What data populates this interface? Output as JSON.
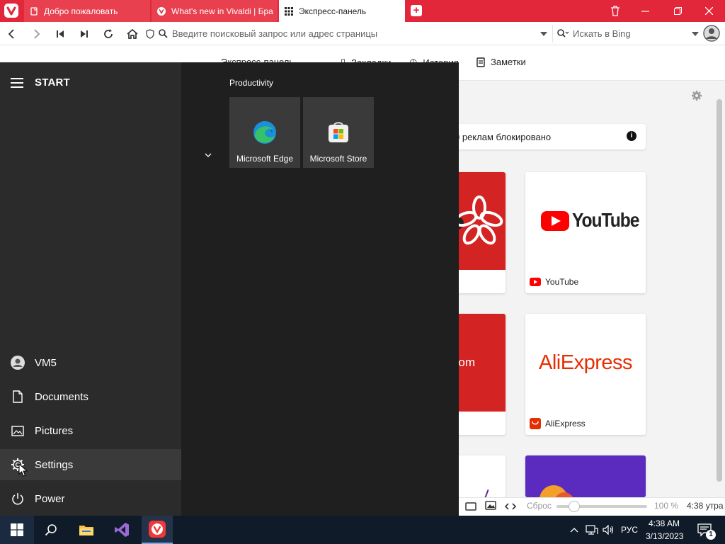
{
  "browser": {
    "tabs": [
      {
        "label": "Добро пожаловать"
      },
      {
        "label": "What's new in Vivaldi | Бра"
      },
      {
        "label": "Экспресс-панель"
      }
    ],
    "address_placeholder": "Введите поисковый запрос или адрес страницы",
    "search_placeholder": "Искать в Bing"
  },
  "bookmark_bar": {
    "items": [
      {
        "label": "Экспресс-панель"
      },
      {
        "label": "Закладки"
      },
      {
        "label": "История"
      },
      {
        "label": "Заметки"
      }
    ]
  },
  "speed_dial": {
    "ads_blocked": "0 реклам блокировано",
    "cards": [
      {
        "title": "YouTube",
        "logo": "YouTube"
      },
      {
        "title": "AliExpress",
        "logo": "AliExpress"
      }
    ],
    "partial_text": "om"
  },
  "status_bar": {
    "reset": "Сброс",
    "zoom": "100 %",
    "time": "4:38 утра"
  },
  "start_menu": {
    "title": "START",
    "group_title": "Productivity",
    "tiles": [
      {
        "label": "Microsoft Edge"
      },
      {
        "label": "Microsoft Store"
      }
    ],
    "rail": [
      {
        "label": "VM5"
      },
      {
        "label": "Documents"
      },
      {
        "label": "Pictures"
      },
      {
        "label": "Settings"
      },
      {
        "label": "Power"
      }
    ]
  },
  "taskbar": {
    "language": "РУС",
    "time": "4:38 AM",
    "date": "3/13/2023",
    "notifications": "1"
  },
  "colors": {
    "vivaldi_red": "#e3273b",
    "start_bg": "#1f1f1f",
    "start_rail": "#2b2b2b",
    "taskbar": "#101b2a"
  }
}
